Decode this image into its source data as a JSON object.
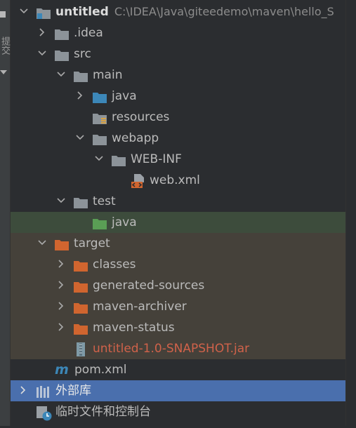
{
  "side_strip": {
    "label": "提交"
  },
  "tree": {
    "root": {
      "name": "untitled",
      "path": "C:\\IDEA\\Java\\giteedemo\\maven\\hello_S"
    },
    "idea": ".idea",
    "src": "src",
    "main": "main",
    "main_java": "java",
    "resources": "resources",
    "webapp": "webapp",
    "web_inf": "WEB-INF",
    "web_xml": "web.xml",
    "test": "test",
    "test_java": "java",
    "target": "target",
    "classes": "classes",
    "generated_sources": "generated-sources",
    "maven_archiver": "maven-archiver",
    "maven_status": "maven-status",
    "jar": "untitled-1.0-SNAPSHOT.jar",
    "pom": "pom.xml",
    "external_libs": "外部库",
    "scratches": "临时文件和控制台"
  },
  "colors": {
    "background": "#2b2d30",
    "folder_gray": "#8c9399",
    "folder_blue": "#3c87b8",
    "folder_green": "#5a9e55",
    "folder_orange": "#d0652f",
    "selection_blue": "#4a6fad",
    "selection_green": "#3d4c3c",
    "target_bg": "#45413a",
    "jar_text": "#d0624a"
  },
  "icons": {
    "chevron_down": "chevron-down-icon",
    "chevron_right": "chevron-right-icon",
    "folder": "folder-icon",
    "xml_file": "xml-file-icon",
    "jar_file": "jar-file-icon",
    "maven": "maven-icon",
    "library": "library-icon",
    "scratch": "scratch-console-icon"
  }
}
